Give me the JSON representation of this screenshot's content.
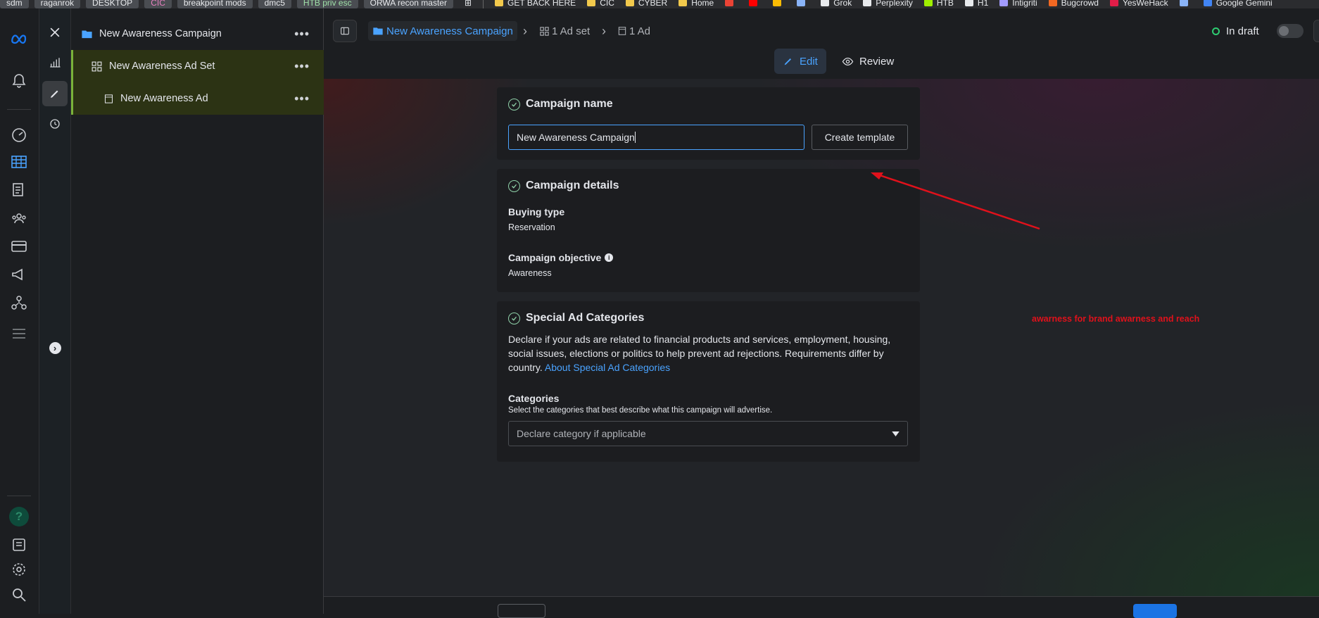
{
  "bookmarks": [
    {
      "label": "sdm",
      "chip": true,
      "color": "#e8eaed"
    },
    {
      "label": "raganrok",
      "chip": true,
      "color": "#e8eaed"
    },
    {
      "label": "DESKTOP",
      "chip": true,
      "color": "#e8eaed"
    },
    {
      "label": "CIC",
      "chip": true,
      "color": "#e77fbf"
    },
    {
      "label": "breakpoint mods",
      "chip": true,
      "color": "#e8eaed"
    },
    {
      "label": "dmc5",
      "chip": true,
      "color": "#e8eaed"
    },
    {
      "label": "HTB priv esc",
      "chip": true,
      "color": "#9fe0a8"
    },
    {
      "label": "ORWA recon master",
      "chip": true,
      "color": "#e8eaed"
    },
    {
      "label": "GET BACK HERE",
      "chip": false,
      "icon": "folder-icon",
      "color": "#e8eaed"
    },
    {
      "label": "CIC",
      "chip": false,
      "icon": "folder-icon",
      "color": "#e8eaed"
    },
    {
      "label": "CYBER",
      "chip": false,
      "icon": "folder-icon",
      "color": "#e8eaed"
    },
    {
      "label": "Home",
      "chip": false,
      "icon": "image-icon",
      "color": "#e8eaed"
    },
    {
      "label": "",
      "chip": false,
      "icon": "gmail-icon",
      "color": "#e8eaed"
    },
    {
      "label": "",
      "chip": false,
      "icon": "youtube-icon",
      "color": "#e8eaed"
    },
    {
      "label": "",
      "chip": false,
      "icon": "photos-icon",
      "color": "#e8eaed"
    },
    {
      "label": "",
      "chip": false,
      "icon": "globe-icon",
      "color": "#e8eaed"
    },
    {
      "label": "Grok",
      "chip": false,
      "icon": "grok-icon",
      "color": "#e8eaed"
    },
    {
      "label": "Perplexity",
      "chip": false,
      "icon": "perplexity-icon",
      "color": "#e8eaed"
    },
    {
      "label": "HTB",
      "chip": false,
      "icon": "htb-icon",
      "color": "#e8eaed"
    },
    {
      "label": "H1",
      "chip": false,
      "icon": "h1-icon",
      "color": "#e8eaed"
    },
    {
      "label": "Intigriti",
      "chip": false,
      "icon": "intigriti-icon",
      "color": "#e8eaed"
    },
    {
      "label": "Bugcrowd",
      "chip": false,
      "icon": "bugcrowd-icon",
      "color": "#e8eaed"
    },
    {
      "label": "YesWeHack",
      "chip": false,
      "icon": "yeswehack-icon",
      "color": "#e8eaed"
    },
    {
      "label": "",
      "chip": false,
      "icon": "link-icon",
      "color": "#e8eaed"
    },
    {
      "label": "Google Gemini",
      "chip": false,
      "icon": "gemini-icon",
      "color": "#e8eaed"
    }
  ],
  "tree": {
    "campaign": "New Awareness Campaign",
    "adset": "New Awareness Ad Set",
    "ad": "New Awareness Ad",
    "more": "•••"
  },
  "breadcrumb": {
    "campaign": "New Awareness Campaign",
    "adset": "1 Ad set",
    "ad": "1 Ad",
    "separator": "›"
  },
  "status": {
    "label": "In draft"
  },
  "modes": {
    "edit": "Edit",
    "review": "Review"
  },
  "campaign_name": {
    "title": "Campaign name",
    "value": "New Awareness Campaign",
    "template_button": "Create template"
  },
  "campaign_details": {
    "title": "Campaign details",
    "buying_type_label": "Buying type",
    "buying_type_value": "Reservation",
    "objective_label": "Campaign objective",
    "objective_value": "Awareness"
  },
  "special_ad": {
    "title": "Special Ad Categories",
    "description": "Declare if your ads are related to financial products and services, employment, housing, social issues, elections or politics to help prevent ad rejections. Requirements differ by country.",
    "link": "About Special Ad Categories",
    "categories_label": "Categories",
    "categories_hint": "Select the categories that best describe what this campaign will advertise.",
    "dropdown_placeholder": "Declare category if applicable"
  },
  "annotation": {
    "text": "awarness for brand awarness and reach",
    "color": "#e0111b"
  },
  "colors": {
    "accent": "#4aa3ff",
    "selected_row": "#2c3314",
    "draft_dot": "#2ecc71",
    "check": "#8fd1a8"
  }
}
